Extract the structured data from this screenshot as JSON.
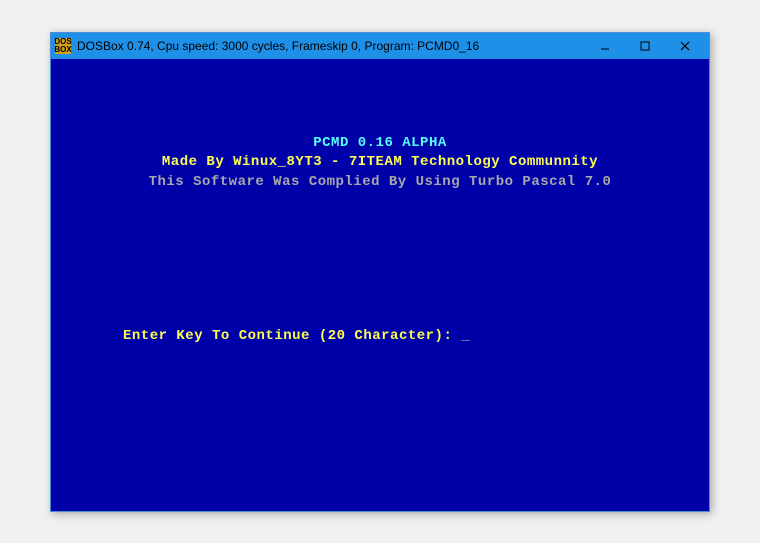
{
  "window": {
    "icon_text": "DOS\nBOX",
    "title": "DOSBox 0.74, Cpu speed:    3000 cycles, Frameskip  0, Program: PCMD0_16"
  },
  "program": {
    "title": "PCMD 0.16 ALPHA",
    "author": "Made By Winux_8YT3 - 7ITEAM Technology Communnity",
    "compiler": "This Software Was Complied By Using Turbo Pascal 7.0",
    "prompt": "Enter Key To Continue (20 Character): ",
    "cursor": "_"
  }
}
